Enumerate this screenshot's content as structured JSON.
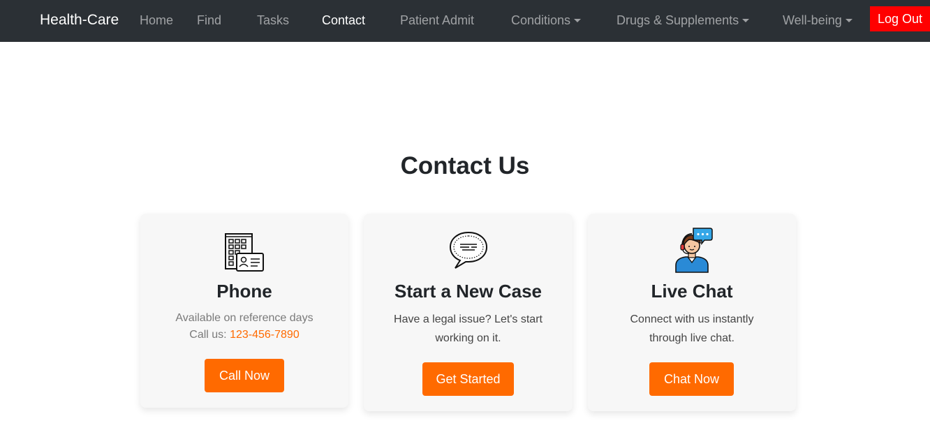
{
  "navbar": {
    "brand": "Health-Care",
    "links": [
      {
        "label": "Home"
      },
      {
        "label": "Find"
      },
      {
        "label": "Tasks"
      },
      {
        "label": "Contact"
      },
      {
        "label": "Patient Admit"
      },
      {
        "label": "Conditions"
      },
      {
        "label": "Drugs & Supplements"
      },
      {
        "label": "Well-being"
      }
    ],
    "active": "Contact",
    "logout_label": "Log Out",
    "colors": {
      "background": "#2b3035",
      "logout": "#ff0000"
    }
  },
  "page": {
    "title": "Contact Us"
  },
  "cards": [
    {
      "icon": "office-building-id-card-icon",
      "title": "Phone",
      "line1": "Available on reference days",
      "call_prefix": "Call us:",
      "phone": "123-456-7890",
      "button": "Call Now"
    },
    {
      "icon": "speech-bubble-icon",
      "title": "Start a New Case",
      "line1": "Have a legal issue? Let's start",
      "line2": "working on it.",
      "button": "Get Started"
    },
    {
      "icon": "support-agent-chat-icon",
      "title": "Live Chat",
      "line1": "Connect with us instantly",
      "line2": "through live chat.",
      "button": "Chat Now"
    }
  ],
  "colors": {
    "accent": "#ff6a00",
    "card_bg": "#f7f7f7"
  }
}
